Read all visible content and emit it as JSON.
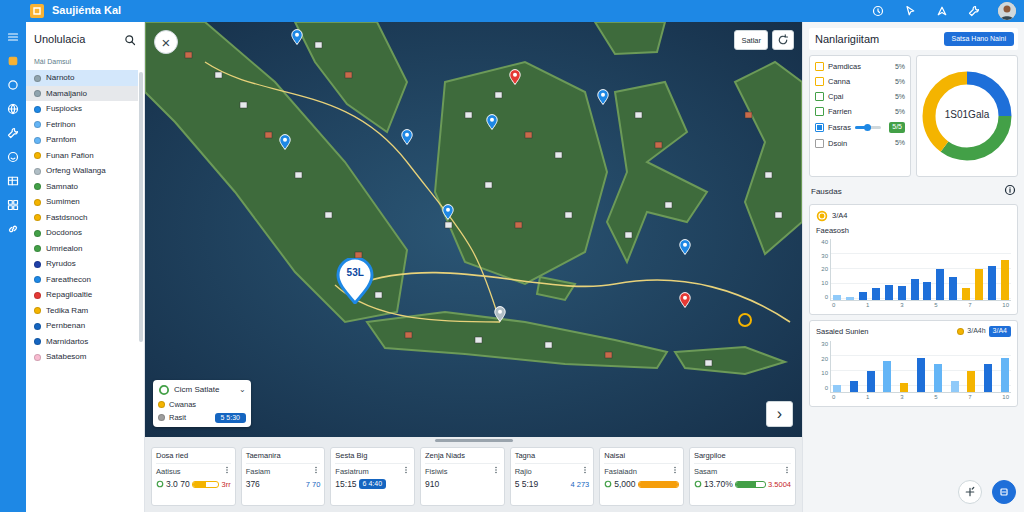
{
  "app": {
    "title": "Saujiénta Kal"
  },
  "sidebar": {
    "title": "Unolulacia",
    "section": "Mái Damsul",
    "items": [
      {
        "label": "Narnoto",
        "color": "#90a4ae",
        "selected": true,
        "hovered": false
      },
      {
        "label": "Mamaljanio",
        "color": "#90a4ae",
        "selected": false,
        "hovered": true
      },
      {
        "label": "Fuspiocks",
        "color": "#1e88e5",
        "selected": false,
        "hovered": false
      },
      {
        "label": "Fetrihon",
        "color": "#64b5f6",
        "selected": false,
        "hovered": false
      },
      {
        "label": "Parnfom",
        "color": "#64b5f6",
        "selected": false,
        "hovered": false
      },
      {
        "label": "Funan Pafion",
        "color": "#f4b400",
        "selected": false,
        "hovered": false
      },
      {
        "label": "Orfeng Wallanga",
        "color": "#b0bec5",
        "selected": false,
        "hovered": false
      },
      {
        "label": "Samnato",
        "color": "#43a047",
        "selected": false,
        "hovered": false
      },
      {
        "label": "Sumimen",
        "color": "#f4b400",
        "selected": false,
        "hovered": false
      },
      {
        "label": "Fastdsnoch",
        "color": "#f4b400",
        "selected": false,
        "hovered": false
      },
      {
        "label": "Docdonos",
        "color": "#43a047",
        "selected": false,
        "hovered": false
      },
      {
        "label": "Umriealon",
        "color": "#43a047",
        "selected": false,
        "hovered": false
      },
      {
        "label": "Ryrudos",
        "color": "#1e3fa8",
        "selected": false,
        "hovered": false
      },
      {
        "label": "Fareathecon",
        "color": "#1e88e5",
        "selected": false,
        "hovered": false
      },
      {
        "label": "Repagiloaltie",
        "color": "#e53935",
        "selected": false,
        "hovered": false
      },
      {
        "label": "Tedika Ram",
        "color": "#f4b400",
        "selected": false,
        "hovered": false
      },
      {
        "label": "Pernbenan",
        "color": "#1565c0",
        "selected": false,
        "hovered": false
      },
      {
        "label": "Marnidartos",
        "color": "#1565c0",
        "selected": false,
        "hovered": false
      },
      {
        "label": "Satabesom",
        "color": "#f8bbd0",
        "selected": false,
        "hovered": false
      }
    ]
  },
  "map": {
    "close": "×",
    "next": "›",
    "filter": "Satlar",
    "focus_pin": {
      "label": "53L"
    },
    "pins": [
      {
        "color": "#e53935"
      },
      {
        "color": "#e53935"
      },
      {
        "color": "#b0bec5"
      },
      {
        "color": "#1e88e5"
      },
      {
        "color": "#1e88e5"
      },
      {
        "color": "#1e88e5"
      },
      {
        "color": "#1e88e5"
      },
      {
        "color": "#1e88e5"
      },
      {
        "color": "#1e88e5"
      },
      {
        "color": "#1e88e5"
      }
    ],
    "card": {
      "title": "Cicm Satlate",
      "toggle": "⌄",
      "items": [
        {
          "label": "Cwanas",
          "color": "#f4b400"
        },
        {
          "label": "Rasit",
          "color": "#9e9e9e",
          "badge": "5 5:30"
        }
      ]
    }
  },
  "stats": [
    {
      "title": "Dosa ried",
      "label": "Aatisus",
      "value": "3.0 70",
      "kind": "bar",
      "level": 0.5,
      "color": "#f4b400",
      "extra": "3rr"
    },
    {
      "title": "Taemanira",
      "label": "Fasiam",
      "value": "376",
      "kind": "text",
      "extra": "7 70"
    },
    {
      "title": "Sesta Big",
      "label": "Fasiatrum",
      "value": "15:15",
      "kind": "badge",
      "color": "#1565c0",
      "extra": "6 4:40"
    },
    {
      "title": "Zenja Niads",
      "label": "Fisiwis",
      "value": "910",
      "kind": "plain"
    },
    {
      "title": "Tagna",
      "label": "Rajio",
      "value": "5 5:19",
      "kind": "text",
      "extra": "4 273"
    },
    {
      "title": "Naisai",
      "label": "Fasiaiadn",
      "value": "5,000",
      "kind": "bar",
      "level": 1,
      "color": "#f59e0b"
    },
    {
      "title": "Sargpiloe",
      "label": "Sasam",
      "value": "13.70%",
      "kind": "bar",
      "level": 0.7,
      "color": "#43a047",
      "extra": "3.5004"
    }
  ],
  "right": {
    "title": "Nanlarigiitam",
    "action": "Satsa Hano Naini",
    "legend": [
      {
        "label": "Pamdicas",
        "value": "5%",
        "checked": false,
        "color": "#f4b400",
        "kind": "check"
      },
      {
        "label": "Canna",
        "value": "5%",
        "checked": false,
        "color": "#f4b400",
        "kind": "check"
      },
      {
        "label": "Cpai",
        "value": "5%",
        "checked": false,
        "color": "#43a047",
        "kind": "check"
      },
      {
        "label": "Farrien",
        "value": "5%",
        "checked": false,
        "color": "#43a047",
        "kind": "check"
      },
      {
        "label": "Fasras",
        "value": "5/5",
        "checked": true,
        "color": "#1e88e5",
        "kind": "slider",
        "level": 0.6
      },
      {
        "label": "Dsoin",
        "value": "5%",
        "checked": false,
        "color": "#9e9e9e",
        "kind": "check"
      }
    ],
    "donut": {
      "center": "1S01Gala",
      "values": [
        25,
        35,
        40
      ],
      "colors": [
        "#1e6fd9",
        "#43a047",
        "#f4b400"
      ]
    },
    "section": "Fausdas",
    "coin": {
      "label": "3/A4"
    },
    "chart1": {
      "title": "Faeasosh",
      "ticks": [
        "40",
        "30",
        "20",
        "10",
        "0"
      ],
      "x_labels": [
        "0",
        "1",
        "3",
        "5",
        "7",
        "10"
      ],
      "values": [
        3,
        2,
        5,
        8,
        10,
        9,
        14,
        12,
        20,
        15,
        8,
        20,
        22,
        26
      ],
      "colors": [
        "#90caf9",
        "#90caf9",
        "#1e6fd9",
        "#1e6fd9",
        "#1e6fd9",
        "#1e6fd9",
        "#1e6fd9",
        "#1e6fd9",
        "#1e6fd9",
        "#1e6fd9",
        "#f4b400",
        "#f4b400",
        "#1e6fd9",
        "#f4b400"
      ]
    },
    "chart2": {
      "title": "Sasaled Sunien",
      "legend": "3/A4h",
      "legend_color": "#f4b400",
      "badge": "3/A4",
      "ticks": [
        "30",
        "20",
        "10",
        "0"
      ],
      "x_labels": [
        "0",
        "1",
        "3",
        "5",
        "7",
        "10"
      ],
      "values": [
        4,
        6,
        12,
        18,
        5,
        20,
        16,
        6,
        12,
        16,
        20
      ],
      "colors": [
        "#90caf9",
        "#1e6fd9",
        "#1e6fd9",
        "#64b5f6",
        "#f4b400",
        "#1e6fd9",
        "#64b5f6",
        "#90caf9",
        "#f4b400",
        "#1e6fd9",
        "#64b5f6"
      ]
    }
  }
}
